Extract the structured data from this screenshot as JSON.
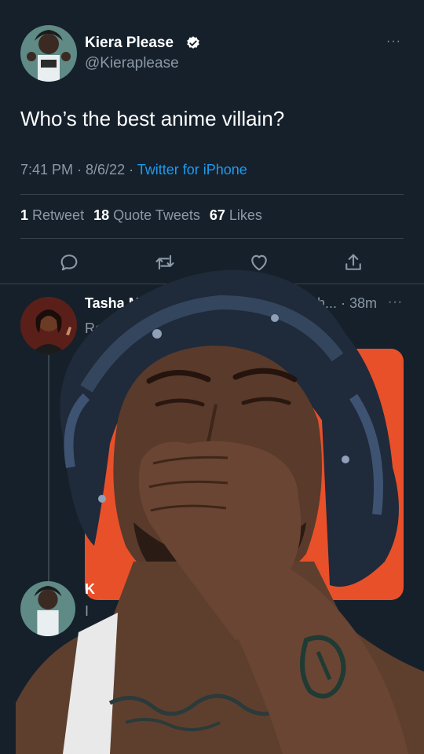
{
  "tweet": {
    "author_name": "Kiera Please",
    "author_handle": "@Kieraplease",
    "more": "···",
    "text": "Who’s the best anime villain?",
    "time": "7:41 PM · 8/6/22 · ",
    "source": "Twitter for iPhone",
    "stats": {
      "retweets_count": "1",
      "retweets_label": "Retweet",
      "quotes_count": "18",
      "quotes_label": "Quote Tweets",
      "likes_count": "67",
      "likes_label": "Likes"
    }
  },
  "reply": {
    "name_partial": "Tasha Mac",
    "time_partial": "sh... · 38m",
    "more": "···",
    "replying_partial": "Replying"
  },
  "reply2": {
    "name_partial": "K",
    "line_partial": "I"
  },
  "icons": [
    "reply-icon",
    "retweet-icon",
    "like-icon",
    "share-icon",
    "verified-icon"
  ],
  "colors": {
    "background": "#15202b",
    "accent": "#1d9bf0",
    "muted": "#8b98a5",
    "divider": "#38444d",
    "media": "#e8502a"
  }
}
